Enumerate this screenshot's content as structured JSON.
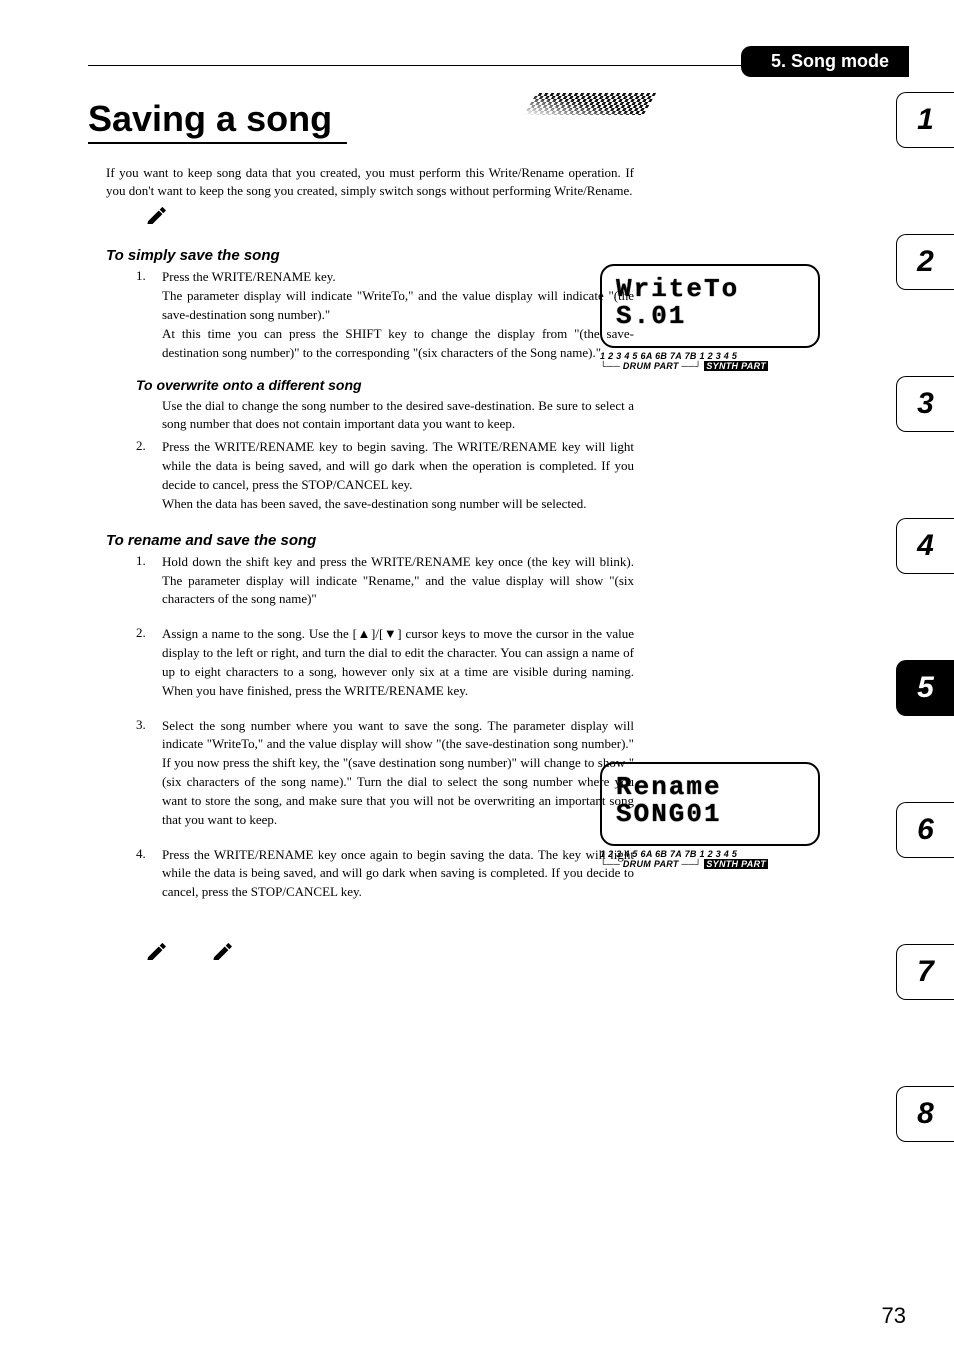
{
  "header": {
    "section": "5. Song mode"
  },
  "title": "Saving a song",
  "intro": "If you want to keep song data that you created, you must perform this Write/Rename operation. If you don't want to keep the song you created, simply switch songs without performing Write/Rename.",
  "h_simple": "To simply save the song",
  "simple_steps": [
    {
      "n": "1.",
      "lines": [
        "Press the WRITE/RENAME key.",
        "The parameter display will indicate \"WriteTo,\" and the value display will indicate \"(the save-destination song number).\"",
        "At this time you can press the SHIFT key to change the display from \"(the save-destination song number)\" to the corresponding \"(six characters of the Song name).\""
      ]
    }
  ],
  "h_overwrite": "To overwrite onto a different song",
  "overwrite_para": "Use the dial to change the song number to the desired save-destination. Be sure to select a song number that does not contain important data you want to keep.",
  "overwrite_steps": [
    {
      "n": "2.",
      "lines": [
        "Press the WRITE/RENAME key to begin saving. The WRITE/RENAME key will light while the data is being saved, and will go dark when the operation is completed. If you decide to cancel, press the STOP/CANCEL key.",
        "When the data has been saved, the save-destination song number will be selected."
      ]
    }
  ],
  "h_rename": "To rename and save the song",
  "rename_steps": [
    {
      "n": "1.",
      "text": "Hold down the shift key and press the WRITE/RENAME key once (the key will blink). The parameter display will indicate \"Rename,\" and the value display will show \"(six characters of the song name)\""
    },
    {
      "n": "2.",
      "text": "Assign a name to the song. Use the [▲]/[▼] cursor keys to move the cursor in the value display to the left or right, and turn the dial to edit the character. You can assign a name of up to eight characters to a song, however only six at a time are visible during naming. When you have finished, press the WRITE/RENAME key."
    },
    {
      "n": "3.",
      "text": "Select the song number where you want to save the song. The parameter display will indicate \"WriteTo,\" and the value display will show \"(the save-destination song number).\" If you now press the shift key, the \"(save destination song number)\" will change to show \"(six characters of the song name).\" Turn the dial to select the song number where you want to store the song, and make sure that you will not be overwriting an important song that you want to keep."
    },
    {
      "n": "4.",
      "text": "Press the WRITE/RENAME key once again to begin saving the data. The key will light while the data is being saved, and will go dark when saving is completed. If you decide to cancel, press the STOP/CANCEL key."
    }
  ],
  "displays": {
    "d1": {
      "line1": "WriteTo",
      "line2": "S.01"
    },
    "d2": {
      "line1": "Rename",
      "line2": "SONG01"
    },
    "partbar_nums": "1 2 3 4 5 6A 6B 7A 7B 1 2 3 4 5",
    "partbar_drum": "DRUM PART",
    "partbar_synth": "SYNTH PART"
  },
  "tabs": [
    "1",
    "2",
    "3",
    "4",
    "5",
    "6",
    "7",
    "8"
  ],
  "active_tab": "5",
  "page_number": "73"
}
